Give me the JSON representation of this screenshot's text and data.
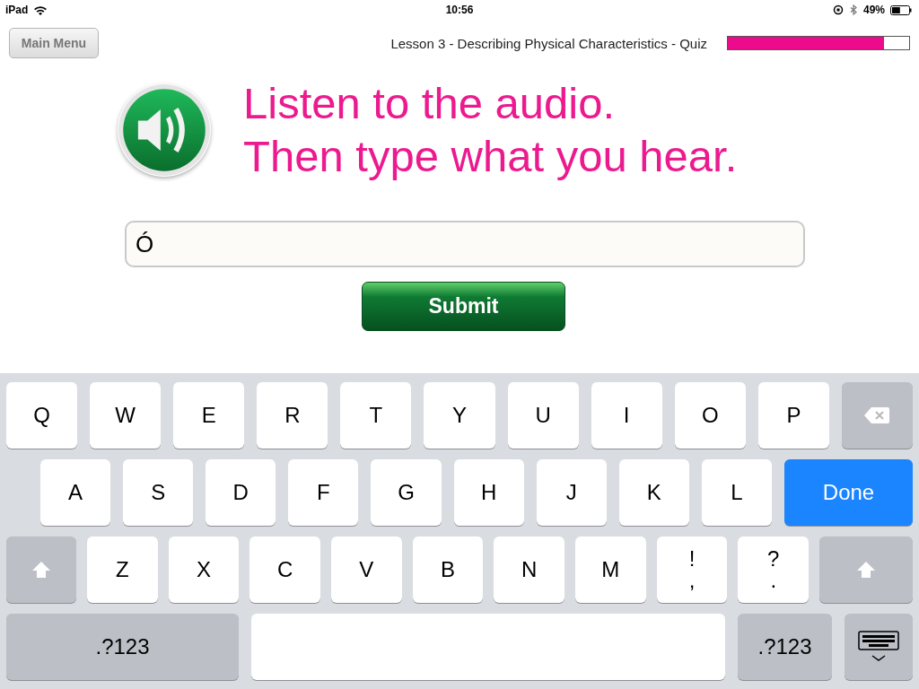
{
  "status_bar": {
    "device": "iPad",
    "time": "10:56",
    "battery": "49%"
  },
  "header": {
    "menu_button": "Main Menu",
    "title": "Lesson 3 - Describing Physical Characteristics - Quiz",
    "progress": {
      "level": 0.86
    }
  },
  "prompt": {
    "lines": [
      "Listen to the audio.",
      "Then type what you hear."
    ]
  },
  "answer": {
    "value": "Ó"
  },
  "submit_button": "Submit",
  "keyboard": {
    "rows": [
      {
        "keys": [
          {
            "kind": "letter",
            "label": "Q"
          },
          {
            "kind": "letter",
            "label": "W"
          },
          {
            "kind": "letter",
            "label": "E"
          },
          {
            "kind": "letter",
            "label": "R"
          },
          {
            "kind": "letter",
            "label": "T"
          },
          {
            "kind": "letter",
            "label": "Y"
          },
          {
            "kind": "letter",
            "label": "U"
          },
          {
            "kind": "letter",
            "label": "I"
          },
          {
            "kind": "letter",
            "label": "O"
          },
          {
            "kind": "letter",
            "label": "P"
          },
          {
            "kind": "backspace"
          }
        ]
      },
      {
        "keys": [
          {
            "kind": "letter",
            "label": "A"
          },
          {
            "kind": "letter",
            "label": "S"
          },
          {
            "kind": "letter",
            "label": "D"
          },
          {
            "kind": "letter",
            "label": "F"
          },
          {
            "kind": "letter",
            "label": "G"
          },
          {
            "kind": "letter",
            "label": "H"
          },
          {
            "kind": "letter",
            "label": "J"
          },
          {
            "kind": "letter",
            "label": "K"
          },
          {
            "kind": "letter",
            "label": "L"
          },
          {
            "kind": "done",
            "label": "Done"
          }
        ]
      },
      {
        "keys": [
          {
            "kind": "shift"
          },
          {
            "kind": "letter",
            "label": "Z"
          },
          {
            "kind": "letter",
            "label": "X"
          },
          {
            "kind": "letter",
            "label": "C"
          },
          {
            "kind": "letter",
            "label": "V"
          },
          {
            "kind": "letter",
            "label": "B"
          },
          {
            "kind": "letter",
            "label": "N"
          },
          {
            "kind": "letter",
            "label": "M"
          },
          {
            "kind": "punct",
            "label": "!",
            "sub": ","
          },
          {
            "kind": "punct",
            "label": "?",
            "sub": "."
          },
          {
            "kind": "shift"
          }
        ]
      },
      {
        "keys": [
          {
            "kind": "numbers",
            "label": ".?123"
          },
          {
            "kind": "space"
          },
          {
            "kind": "numbers",
            "label": ".?123"
          },
          {
            "kind": "hide"
          }
        ]
      }
    ]
  }
}
